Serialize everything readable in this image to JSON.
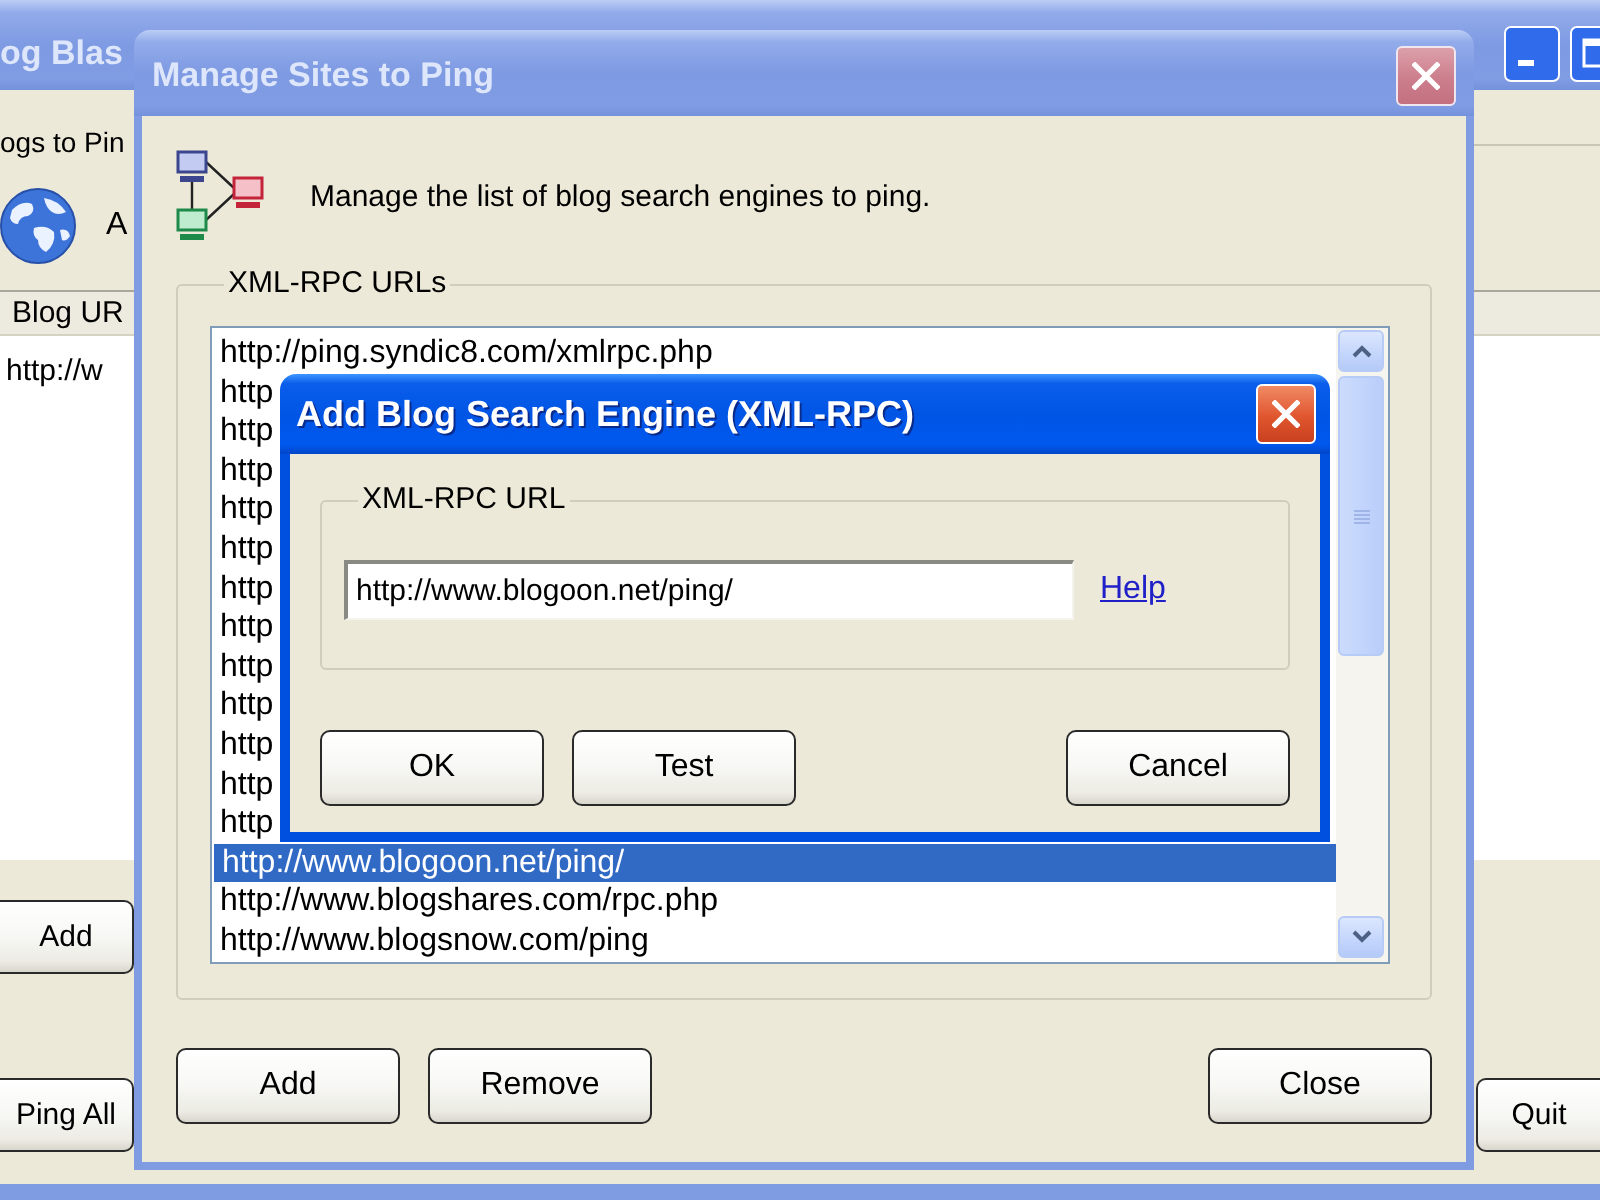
{
  "main_window": {
    "title": "og Blas",
    "active": false,
    "heading": "ogs to Pin",
    "intro_text": "A",
    "table": {
      "columns": [
        "Blog UR"
      ],
      "rows": [
        [
          "http://w"
        ]
      ]
    },
    "button_rows": [
      [
        "Add"
      ],
      [
        "Ping All",
        "Quit"
      ]
    ]
  },
  "manage_dialog": {
    "title": "Manage Sites to Ping",
    "active": false,
    "description": "Manage the list of blog search engines to ping.",
    "group_label": "XML-RPC URLs",
    "urls": [
      {
        "text": "http://ping.syndic8.com/xmlrpc.php",
        "selected": false
      },
      {
        "text": "http",
        "selected": false
      },
      {
        "text": "http",
        "selected": false
      },
      {
        "text": "http",
        "selected": false
      },
      {
        "text": "http",
        "selected": false
      },
      {
        "text": "http",
        "selected": false
      },
      {
        "text": "http",
        "selected": false
      },
      {
        "text": "http",
        "selected": false
      },
      {
        "text": "http",
        "selected": false
      },
      {
        "text": "http",
        "selected": false
      },
      {
        "text": "http",
        "selected": false
      },
      {
        "text": "http",
        "selected": false
      },
      {
        "text": "http",
        "selected": false
      },
      {
        "text": "http://www.blogoon.net/ping/",
        "selected": true
      },
      {
        "text": "http://www.blogshares.com/rpc.php",
        "selected": false
      },
      {
        "text": "http://www.blogsnow.com/ping",
        "selected": false
      }
    ],
    "left_buttons": [
      "Add",
      "Remove"
    ],
    "right_buttons": [
      "Close"
    ]
  },
  "add_dialog": {
    "title": "Add Blog Search Engine (XML-RPC)",
    "active": true,
    "group_label": "XML-RPC URL",
    "url_field": {
      "value": "http://www.blogoon.net/ping/"
    },
    "help_link": "Help",
    "left_buttons": [
      "OK",
      "Test"
    ],
    "right_buttons": [
      "Cancel"
    ]
  }
}
